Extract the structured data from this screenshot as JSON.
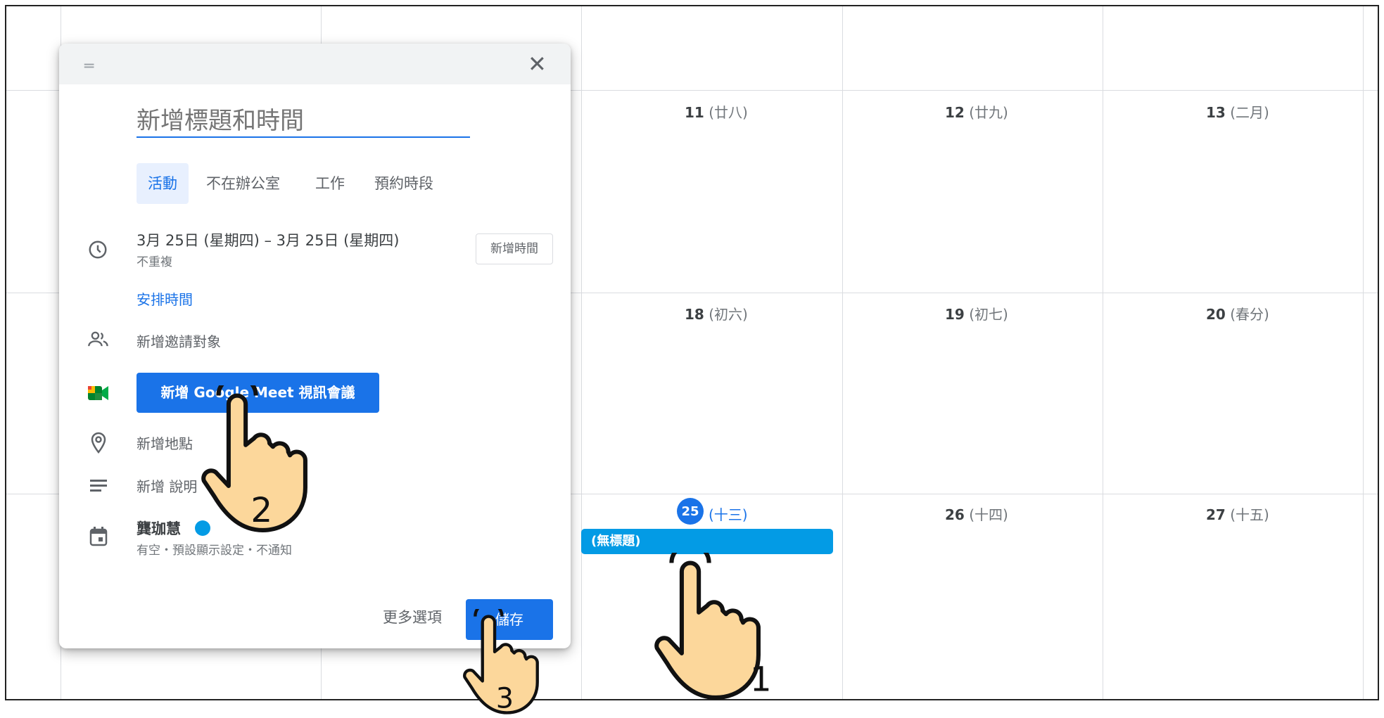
{
  "calendar": {
    "cells": [
      {
        "day": "11",
        "lunar": "(廿八)"
      },
      {
        "day": "12",
        "lunar": "(廿九)"
      },
      {
        "day": "13",
        "lunar": "(二月)"
      },
      {
        "day": "18",
        "lunar": "(初六)"
      },
      {
        "day": "19",
        "lunar": "(初七)"
      },
      {
        "day": "20",
        "lunar": "(春分)"
      },
      {
        "day": "26",
        "lunar": "(十四)"
      },
      {
        "day": "27",
        "lunar": "(十五)"
      }
    ],
    "today": {
      "day": "25",
      "lunar": "(十三)"
    },
    "event_chip": "(無標題)"
  },
  "dialog": {
    "title_placeholder": "新增標題和時間",
    "tabs": [
      "活動",
      "不在辦公室",
      "工作",
      "預約時段"
    ],
    "date_range": "3月 25日 (星期四)  –  3月 25日 (星期四)",
    "repeat": "不重複",
    "add_time_button": "新增時間",
    "schedule_link": "安排時間",
    "add_guests": "新增邀請對象",
    "meet_button": "新增 Google Meet 視訊會議",
    "add_location": "新增地點",
    "add_description": "新增 說明",
    "calendar_owner": "龔珈慧",
    "status_line": "有空・預設顯示設定・不通知",
    "more_options": "更多選項",
    "save_button": "儲存",
    "accent_color": "#1a73e8",
    "event_color": "#039be5"
  },
  "annotations": {
    "hand_1": "1",
    "hand_2": "2",
    "hand_3": "3"
  }
}
